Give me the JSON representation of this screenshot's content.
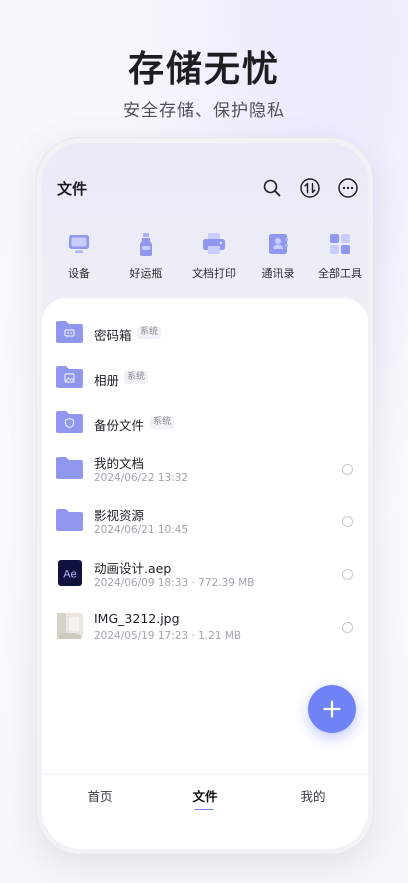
{
  "promo": {
    "title": "存储无忧",
    "subtitle": "安全存储、保护隐私"
  },
  "header": {
    "title": "文件",
    "icons": [
      "search-icon",
      "transfer-icon",
      "more-icon"
    ]
  },
  "tools": [
    {
      "label": "设备",
      "icon": "device-icon"
    },
    {
      "label": "好运瓶",
      "icon": "bottle-icon"
    },
    {
      "label": "文档打印",
      "icon": "printer-icon"
    },
    {
      "label": "通讯录",
      "icon": "contacts-icon"
    },
    {
      "label": "全部工具",
      "icon": "all-tools-icon"
    }
  ],
  "files": [
    {
      "name": "密码箱",
      "badge": "系统",
      "icon": "password-folder-icon"
    },
    {
      "name": "相册",
      "badge": "系统",
      "icon": "album-folder-icon"
    },
    {
      "name": "备份文件",
      "badge": "系统",
      "icon": "backup-folder-icon"
    },
    {
      "name": "我的文档",
      "meta": "2024/06/22 13:32",
      "icon": "folder-icon"
    },
    {
      "name": "影视资源",
      "meta": "2024/06/21 10:45",
      "icon": "folder-icon"
    },
    {
      "name": "动画设计.aep",
      "meta": "2024/06/09 18:33 · 772.39 MB",
      "icon": "ae-file-icon",
      "icon_text": "Ae"
    },
    {
      "name": "IMG_3212.jpg",
      "meta": "2024/05/19 17:23 · 1.21 MB",
      "icon": "image-thumbnail"
    }
  ],
  "tabs": [
    {
      "label": "首页",
      "active": false
    },
    {
      "label": "文件",
      "active": true
    },
    {
      "label": "我的",
      "active": false
    }
  ],
  "colors": {
    "accent": "#6f83f6",
    "folder": "#8f97ef"
  }
}
